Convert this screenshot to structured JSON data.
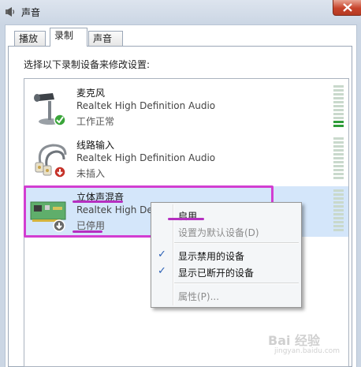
{
  "window": {
    "title": "声音"
  },
  "tabs": [
    {
      "label": "播放",
      "active": false
    },
    {
      "label": "录制",
      "active": true
    },
    {
      "label": "声音",
      "active": false
    }
  ],
  "instruction": "选择以下录制设备来修改设置:",
  "devices": [
    {
      "name": "麦克风",
      "driver": "Realtek High Definition Audio",
      "status": "工作正常",
      "icon": "microphone-icon",
      "badge": "green-check-icon",
      "level": 0.15
    },
    {
      "name": "线路输入",
      "driver": "Realtek High Definition Audio",
      "status": "未插入",
      "icon": "line-in-cable-icon",
      "badge": "red-down-arrow-icon",
      "level": 0
    },
    {
      "name": "立体声混音",
      "driver": "Realtek High Defi",
      "status": "已停用",
      "icon": "sound-card-icon",
      "badge": "gray-down-arrow-icon",
      "level": 0,
      "selected": true
    }
  ],
  "context_menu": {
    "items": [
      {
        "label": "启用",
        "enabled": true,
        "checked": false
      },
      {
        "label": "设置为默认设备(D)",
        "enabled": false,
        "checked": false
      },
      {
        "label": "显示禁用的设备",
        "enabled": true,
        "checked": true
      },
      {
        "label": "显示已断开的设备",
        "enabled": true,
        "checked": true
      },
      {
        "label": "属性(P)...",
        "enabled": false,
        "checked": false
      }
    ]
  },
  "annotation_color": "#d23ed1",
  "watermark": {
    "text": "Bai 经验",
    "sub": "jingyan.baidu.com"
  }
}
